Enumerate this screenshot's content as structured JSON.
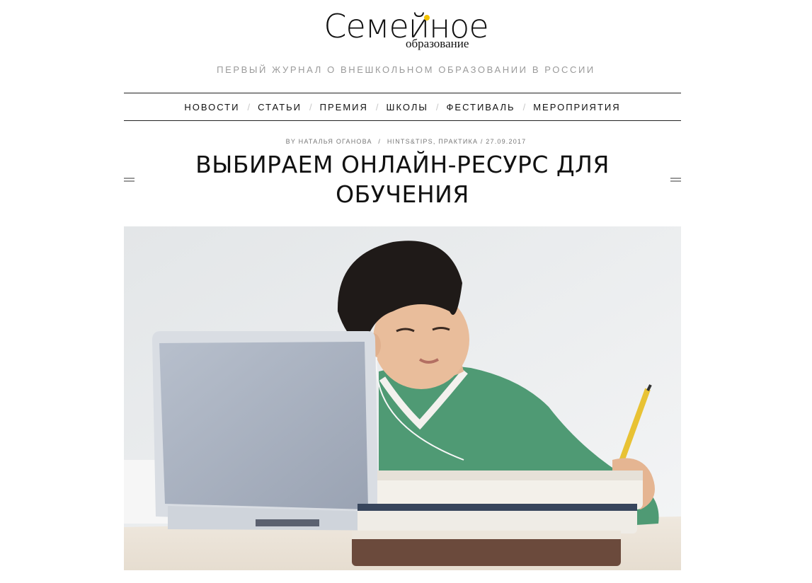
{
  "site": {
    "logo_main": "Семейное",
    "logo_sub": "образование",
    "tagline": "ПЕРВЫЙ ЖУРНАЛ О ВНЕШКОЛЬНОМ ОБРАЗОВАНИИ В РОССИИ"
  },
  "nav": {
    "items": [
      "НОВОСТИ",
      "СТАТЬИ",
      "ПРЕМИЯ",
      "ШКОЛЫ",
      "ФЕСТИВАЛЬ",
      "МЕРОПРИЯТИЯ"
    ],
    "separator": "/"
  },
  "article": {
    "meta_by": "BY",
    "author": "НАТАЛЬЯ ОГАНОВА",
    "categories": "HINTS&TIPS, ПРАКТИКА",
    "date": "27.09.2017",
    "title": "ВЫБИРАЕМ ОНЛАЙН-РЕСУРС ДЛЯ ОБУЧЕНИЯ"
  },
  "colors": {
    "accent_dot": "#f2c200",
    "tagline": "#9a9a9a"
  }
}
